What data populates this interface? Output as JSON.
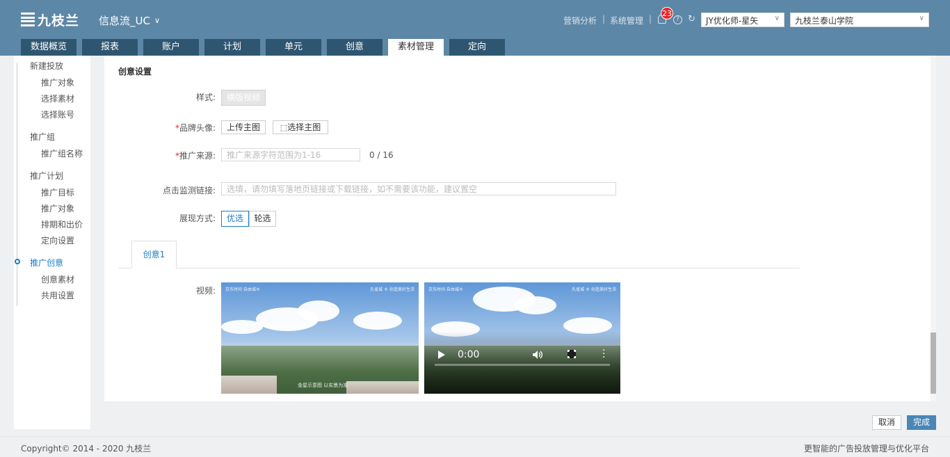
{
  "app": {
    "logo_text": "九枝兰",
    "product": "信息流_UC"
  },
  "header": {
    "links": [
      "营销分析",
      "系统管理"
    ],
    "separator": "|",
    "notifications": "23",
    "help_glyph": "?",
    "refresh_glyph": "↻",
    "optimizer_select": "JY优化师-星矢",
    "account_select": "九枝兰泰山学院"
  },
  "tabs": [
    {
      "label": "数据概览"
    },
    {
      "label": "报表"
    },
    {
      "label": "账户"
    },
    {
      "label": "计划"
    },
    {
      "label": "单元"
    },
    {
      "label": "创意"
    },
    {
      "label": "素材管理",
      "active": true
    },
    {
      "label": "定向"
    }
  ],
  "sidebar": {
    "groups": [
      {
        "label": "新建投放",
        "items": [
          "推广对象",
          "选择素材",
          "选择账号"
        ]
      },
      {
        "label": "推广组",
        "items": [
          "推广组名称"
        ]
      },
      {
        "label": "推广计划",
        "items": [
          "推广目标",
          "推广对象",
          "排期和出价",
          "定向设置"
        ]
      },
      {
        "label": "推广创意",
        "active": true,
        "items": [
          "创意素材",
          "共用设置"
        ]
      }
    ]
  },
  "form": {
    "section_title": "创意设置",
    "style_label": "样式:",
    "style_value": "横版视频",
    "brand_label": "品牌头像:",
    "upload_btn": "上传主图",
    "choose_btn": "选择主图",
    "source_label": "推广来源:",
    "source_placeholder": "推广来源字符范围为1-16",
    "source_counter": "0 / 16",
    "monitor_label": "点击监测链接:",
    "monitor_placeholder": "选填，请勿填写落地页链接或下载链接，如不需要该功能，建议置空",
    "display_label": "展现方式:",
    "display_options": [
      "优选",
      "轮选"
    ],
    "creative_tab": "创意1",
    "video_label": "视频:",
    "required_mark": "*"
  },
  "video": {
    "time": "0:00",
    "watermark_left": "京东时间 自由城®",
    "watermark_right": "孔雀城 ® 创造美好生活",
    "caption": "金星示意图 以实景为准"
  },
  "actions": {
    "cancel": "取消",
    "done": "完成"
  },
  "footer": {
    "copyright": "Copyright© 2014 - 2020 九枝兰",
    "slogan": "更智能的广告投放管理与优化平台"
  },
  "colors": {
    "header": "#5d87a7",
    "tab": "#2f5670",
    "accent": "#1a7bc9",
    "primary_button": "#4a86b6"
  }
}
